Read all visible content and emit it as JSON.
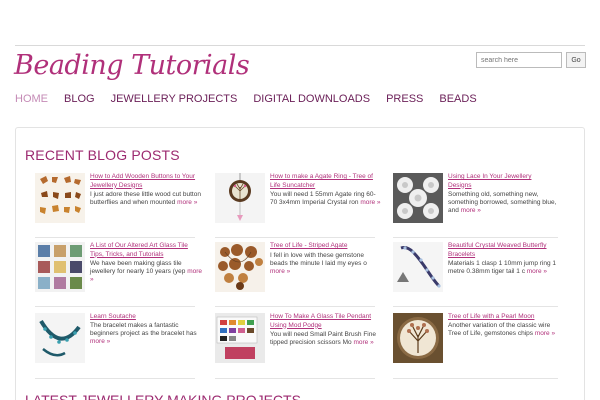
{
  "site": {
    "logo": "Beading Tutorials"
  },
  "search": {
    "placeholder": "search here",
    "button": "Go"
  },
  "nav": [
    "HOME",
    "BLOG",
    "JEWELLERY PROJECTS",
    "DIGITAL DOWNLOADS",
    "PRESS",
    "BEADS"
  ],
  "section": {
    "title": "RECENT BLOG POSTS",
    "title2": "LATEST JEWELLERY MAKING PROJECTS"
  },
  "posts": [
    {
      "title": "How to Add Wooden Buttons to Your Jewellery Designs",
      "excerpt": "I just adore these little wood cut button butterflies and when mounted",
      "more": "more »"
    },
    {
      "title": "How to make a Agate Ring - Tree of Life Suncatcher",
      "excerpt": "You will need 1 55mm Agate ring 60-70 3x4mm Imperial Crystal ron",
      "more": "more »"
    },
    {
      "title": "Using Lace In Your Jewellery Designs",
      "excerpt": "Something old, something new, something borrowed, something blue, and",
      "more": "more »"
    },
    {
      "title": "A List of Our Altered Art Glass Tile Tips, Tricks, and Tutorials",
      "excerpt": "We have been making glass tile jewellery for nearly 10 years (yep",
      "more": "more »"
    },
    {
      "title": "Tree of Life - Striped Agate",
      "excerpt": "I fell in love with these gemstone beads the minute I laid my eyes o",
      "more": "more »"
    },
    {
      "title": "Beautiful Crystal Weaved Butterfly Bracelets",
      "excerpt": "Materials 1 clasp 1 10mm jump ring 1 metre 0.38mm tiger tail 1 c",
      "more": "more »"
    },
    {
      "title": "Learn Soutache",
      "excerpt": "The bracelet makes a fantastic beginners project as the bracelet has",
      "more": "more »"
    },
    {
      "title": "How To Make A Glass Tile Pendant Using Mod Podge",
      "excerpt": "You will need Small Paint Brush Fine tipped precision scissors Mo",
      "more": "more »"
    },
    {
      "title": "Tree of Life with a Pearl Moon",
      "excerpt": "Another variation of the classic wire Tree of Life, gemstones chips",
      "more": "more »"
    }
  ],
  "colors": {
    "brand": "#b0307a",
    "nav": "#6a1e57",
    "nav_active": "#c58bb6"
  }
}
